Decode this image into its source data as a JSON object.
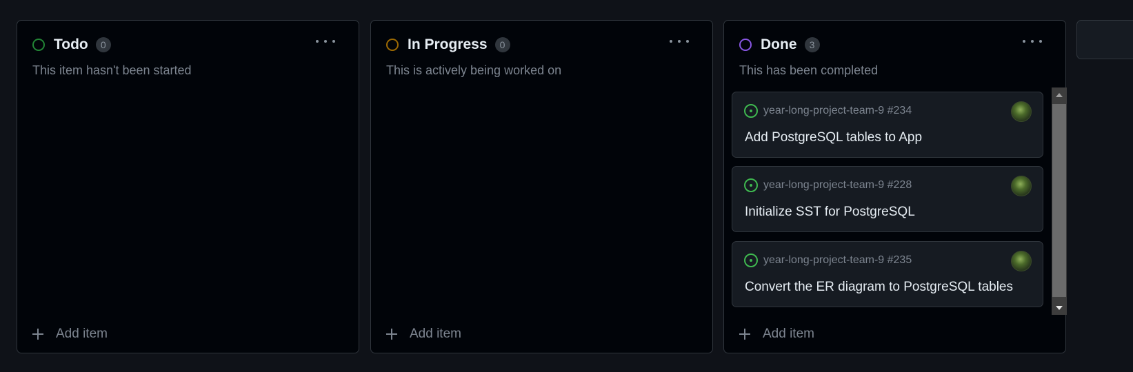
{
  "columns": [
    {
      "title": "Todo",
      "count": "0",
      "description": "This item hasn't been started",
      "status_color": "#238636",
      "add_label": "Add item"
    },
    {
      "title": "In Progress",
      "count": "0",
      "description": "This is actively being worked on",
      "status_color": "#9e6a03",
      "add_label": "Add item"
    },
    {
      "title": "Done",
      "count": "3",
      "description": "This has been completed",
      "status_color": "#8957e5",
      "add_label": "Add item",
      "cards": [
        {
          "repo_ref": "year-long-project-team-9 #234",
          "title": "Add PostgreSQL tables to App",
          "status_icon": "issue-open-icon"
        },
        {
          "repo_ref": "year-long-project-team-9 #228",
          "title": "Initialize SST for PostgreSQL",
          "status_icon": "issue-open-icon"
        },
        {
          "repo_ref": "year-long-project-team-9 #235",
          "title": "Convert the ER diagram to PostgreSQL tables",
          "status_icon": "issue-open-icon"
        }
      ]
    }
  ],
  "colors": {
    "background": "#0f1218",
    "column_bg": "#010409",
    "card_bg": "#161b22",
    "border": "#30363d",
    "issue_open": "#3fb950"
  }
}
